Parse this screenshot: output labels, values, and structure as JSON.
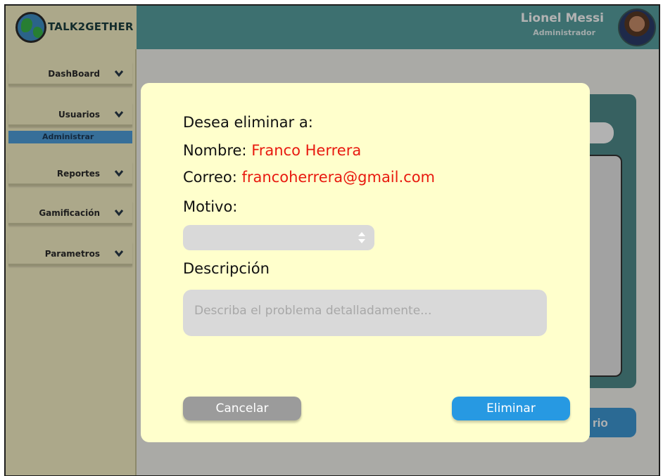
{
  "app": {
    "logo_text": "TALK2GETHER"
  },
  "user": {
    "name": "Lionel Messi",
    "role": "Administrador"
  },
  "sidebar": {
    "items": [
      {
        "label": "DashBoard"
      },
      {
        "label": "Usuarios"
      },
      {
        "label": "Reportes"
      },
      {
        "label": "Gamificación"
      },
      {
        "label": "Parametros"
      }
    ],
    "active_subitem": "Administrar"
  },
  "background": {
    "button_partial_label": "rio"
  },
  "modal": {
    "prompt": "Desea eliminar a:",
    "name_label": "Nombre: ",
    "name_value": "Franco Herrera",
    "email_label": "Correo: ",
    "email_value": "francoherrera@gmail.com",
    "reason_label": "Motivo:",
    "reason_selected": "",
    "description_label": "Descripción",
    "description_placeholder": "Describa el problema detalladamente...",
    "cancel_label": "Cancelar",
    "delete_label": "Eliminar"
  },
  "colors": {
    "header": "#58a1a1",
    "sidebar": "#f7f1c6",
    "modal_bg": "#ffffcc",
    "highlight_red": "#e8190f",
    "primary_blue": "#2799e2",
    "cancel_gray": "#9b9b9b"
  },
  "icons": {
    "logo": "globe-icon",
    "nav_chevron": "chevron-down-icon",
    "select_arrows": "sort-arrows-icon"
  }
}
